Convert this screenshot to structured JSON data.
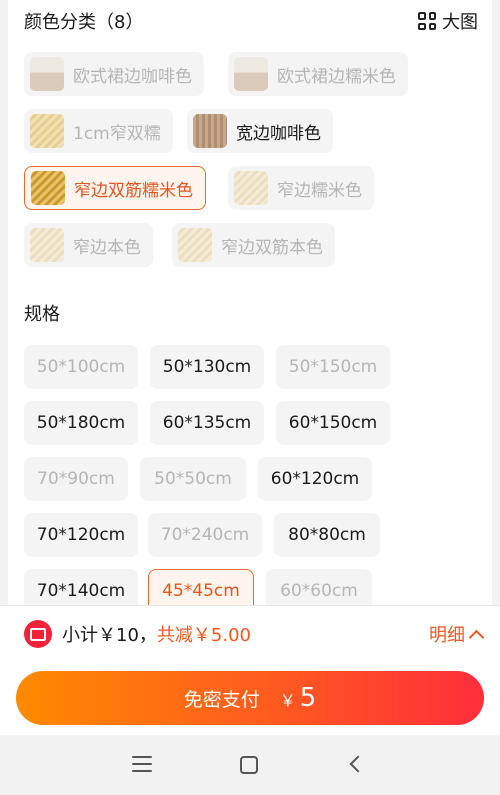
{
  "color_section": {
    "title": "颜色分类（8）",
    "big_view_label": "大图",
    "options": [
      {
        "label": "欧式裙边咖啡色",
        "thumb": "room",
        "state": "disabled"
      },
      {
        "label": "欧式裙边糯米色",
        "thumb": "room",
        "state": "disabled"
      },
      {
        "label": "1cm窄双糯",
        "thumb": "bamboo",
        "state": "disabled"
      },
      {
        "label": "宽边咖啡色",
        "thumb": "coffee",
        "state": "active"
      },
      {
        "label": "窄边双筋糯米色",
        "thumb": "gold",
        "state": "selected"
      },
      {
        "label": "窄边糯米色",
        "thumb": "natural",
        "state": "disabled"
      },
      {
        "label": "窄边本色",
        "thumb": "natural",
        "state": "disabled"
      },
      {
        "label": "窄边双筋本色",
        "thumb": "natural",
        "state": "disabled"
      }
    ]
  },
  "spec_section": {
    "title": "规格",
    "options": [
      {
        "label": "50*100cm",
        "state": "disabled"
      },
      {
        "label": "50*130cm",
        "state": "active"
      },
      {
        "label": "50*150cm",
        "state": "disabled"
      },
      {
        "label": "50*180cm",
        "state": "active"
      },
      {
        "label": "60*135cm",
        "state": "active"
      },
      {
        "label": "60*150cm",
        "state": "active"
      },
      {
        "label": "70*90cm",
        "state": "disabled"
      },
      {
        "label": "50*50cm",
        "state": "disabled"
      },
      {
        "label": "60*120cm",
        "state": "active"
      },
      {
        "label": "70*120cm",
        "state": "active"
      },
      {
        "label": "70*240cm",
        "state": "disabled"
      },
      {
        "label": "80*80cm",
        "state": "active"
      },
      {
        "label": "70*140cm",
        "state": "active"
      },
      {
        "label": "45*45cm",
        "state": "selected"
      },
      {
        "label": "60*60cm",
        "state": "disabled"
      }
    ]
  },
  "summary": {
    "subtotal_text": "小计￥10，",
    "discount_text": "共减￥5.00",
    "detail_label": "明细"
  },
  "pay": {
    "label": "免密支付",
    "currency": "￥",
    "amount": "5"
  },
  "colors": {
    "accent": "#f05a22",
    "selected_border": "#ec6a2c",
    "pay_gradient_start": "#ff8a00",
    "pay_gradient_end": "#ff2d3b"
  },
  "icons": [
    "grid-icon",
    "ticket-icon",
    "chevron-up-icon",
    "menu-icon",
    "home-icon",
    "back-icon"
  ]
}
